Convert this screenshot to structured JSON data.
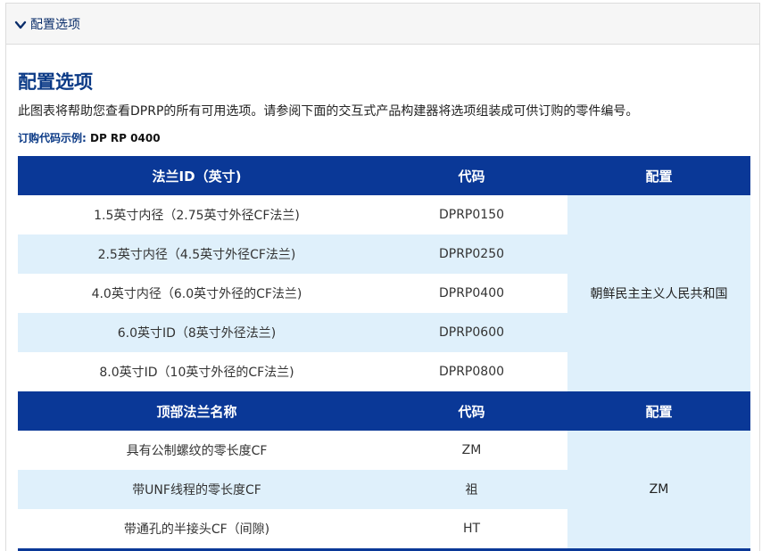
{
  "accordion": {
    "title": "配置选项"
  },
  "section": {
    "title": "配置选项",
    "description": "此图表将帮助您查看DPRP的所有可用选项。请参阅下面的交互式产品构建器将选项组装成可供订购的零件编号。",
    "order_example_label": "订购代码示例:",
    "order_example_code": "DP RP 0400"
  },
  "table1": {
    "headers": [
      "法兰ID（英寸)",
      "代码",
      "配置"
    ],
    "rows": [
      {
        "name": "1.5英寸内径（2.75英寸外径CF法兰)",
        "code": "DPRP0150"
      },
      {
        "name": "2.5英寸内径（4.5英寸外径CF法兰)",
        "code": "DPRP0250"
      },
      {
        "name": "4.0英寸内径（6.0英寸外径的CF法兰)",
        "code": "DPRP0400"
      },
      {
        "name": "6.0英寸ID（8英寸外径法兰)",
        "code": "DPRP0600"
      },
      {
        "name": "8.0英寸ID（10英寸外径的CF法兰)",
        "code": "DPRP0800"
      }
    ],
    "config": "朝鲜民主主义人民共和国"
  },
  "table2": {
    "headers": [
      "顶部法兰名称",
      "代码",
      "配置"
    ],
    "rows": [
      {
        "name": "具有公制螺纹的零长度CF",
        "code": "ZM"
      },
      {
        "name": "带UNF线程的零长度CF",
        "code": "祖"
      },
      {
        "name": "带通孔的半接头CF（间隙)",
        "code": "HT"
      }
    ],
    "config": "ZM"
  },
  "icons": {
    "accordion_toggle": "chevron-down-icon"
  },
  "colors": {
    "header_bg": "#0a3897",
    "row_alt_bg": "#dff0fb",
    "title": "#0b3a86"
  }
}
